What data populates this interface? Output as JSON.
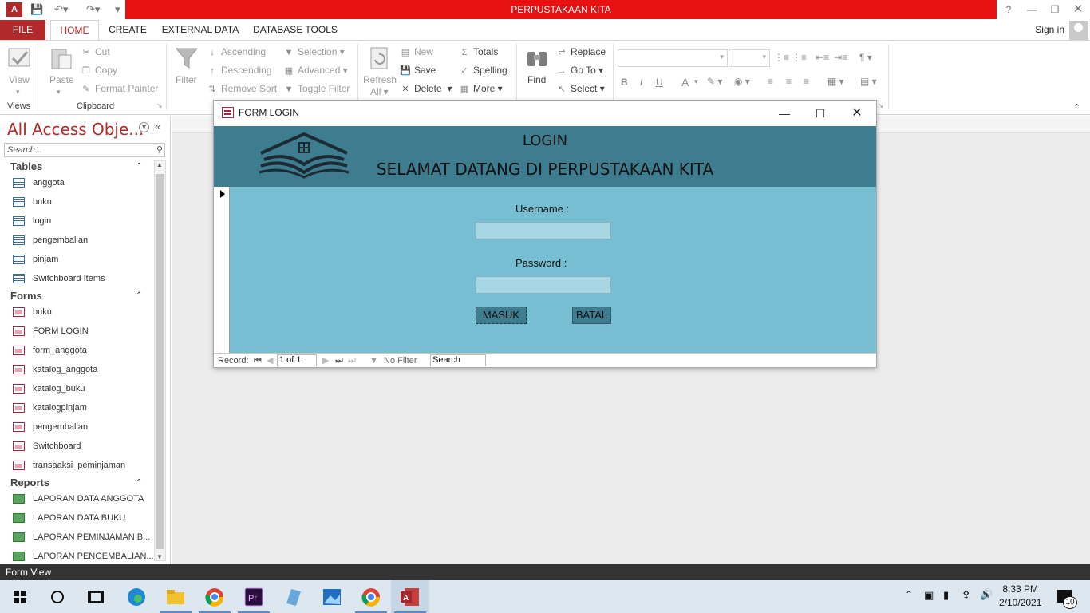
{
  "app": {
    "title": "PERPUSTAKAAN KITA"
  },
  "tabs": [
    "FILE",
    "HOME",
    "CREATE",
    "EXTERNAL DATA",
    "DATABASE TOOLS"
  ],
  "signin": "Sign in",
  "ribbon": {
    "views": {
      "view": "View",
      "group": "Views"
    },
    "clipboard": {
      "paste": "Paste",
      "cut": "Cut",
      "copy": "Copy",
      "format_painter": "Format Painter",
      "group": "Clipboard"
    },
    "sort_filter": {
      "filter": "Filter",
      "ascending": "Ascending",
      "descending": "Descending",
      "remove_sort": "Remove Sort",
      "selection": "Selection",
      "advanced": "Advanced",
      "toggle_filter": "Toggle Filter"
    },
    "records": {
      "refresh": "Refresh",
      "all": "All",
      "new": "New",
      "save": "Save",
      "delete": "Delete",
      "totals": "Totals",
      "spelling": "Spelling",
      "more": "More"
    },
    "find": {
      "find": "Find",
      "replace": "Replace",
      "goto": "Go To",
      "select": "Select"
    },
    "format": {
      "bold": "B",
      "italic": "I",
      "underline": "U",
      "font_color": "A"
    }
  },
  "nav": {
    "title": "All Access Obje...",
    "search_placeholder": "Search...",
    "tables_label": "Tables",
    "tables": [
      "anggota",
      "buku",
      "login",
      "pengembalian",
      "pinjam",
      "Switchboard Items"
    ],
    "forms_label": "Forms",
    "forms": [
      "buku",
      "FORM LOGIN",
      "form_anggota",
      "katalog_anggota",
      "katalog_buku",
      "katalogpinjam",
      "pengembalian",
      "Switchboard",
      "transaaksi_peminjaman"
    ],
    "reports_label": "Reports",
    "reports": [
      "LAPORAN DATA ANGGOTA",
      "LAPORAN DATA BUKU",
      "LAPORAN PEMINJAMAN B...",
      "LAPORAN PENGEMBALIAN..."
    ]
  },
  "form": {
    "window_title": "FORM LOGIN",
    "heading": "LOGIN",
    "welcome": "SELAMAT DATANG DI PERPUSTAKAAN KITA",
    "username_label": "Username :",
    "username_value": "",
    "password_label": "Password :",
    "password_value": "",
    "masuk": "MASUK",
    "batal": "BATAL",
    "record_label": "Record:",
    "record_value": "1 of 1",
    "no_filter": "No Filter",
    "search": "Search"
  },
  "status": {
    "text": "Form View"
  },
  "clock": {
    "time": "8:33 PM",
    "date": "2/10/2021",
    "notifications": "10"
  },
  "colors": {
    "title_red": "#e81010",
    "access_accent": "#b12929",
    "form_header": "#3e7d8f",
    "form_body": "#77bed3"
  }
}
